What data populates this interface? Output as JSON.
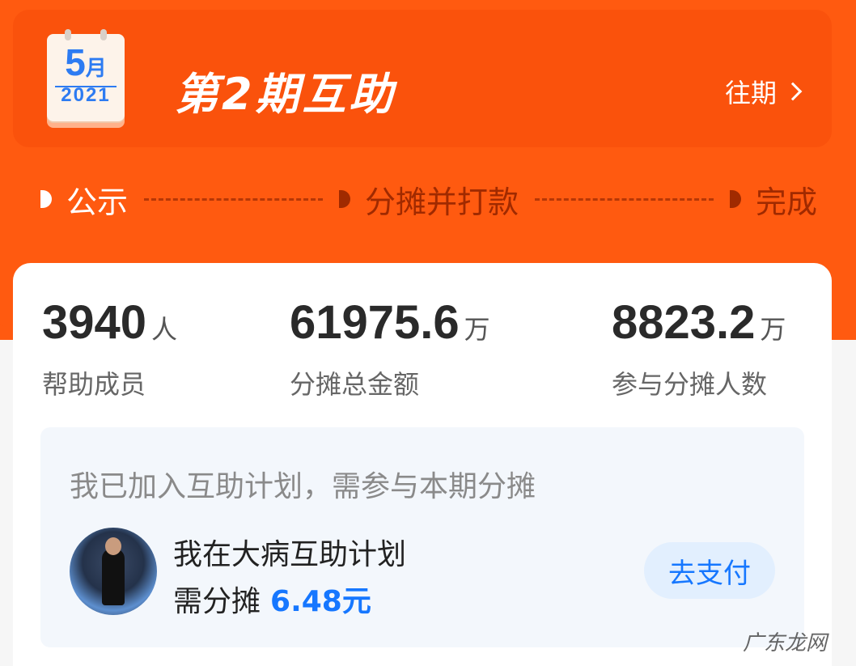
{
  "header": {
    "calendar": {
      "month_number": "5",
      "month_unit": "月",
      "year": "2021"
    },
    "title": "第2期互助",
    "history_label": "往期"
  },
  "steps": [
    {
      "label": "公示",
      "state": "active"
    },
    {
      "label": "分摊并打款",
      "state": "inactive"
    },
    {
      "label": "完成",
      "state": "inactive"
    }
  ],
  "stats": [
    {
      "value": "3940",
      "unit": "人",
      "label": "帮助成员"
    },
    {
      "value": "61975.6",
      "unit": "万",
      "label": "分摊总金额"
    },
    {
      "value": "8823.2",
      "unit": "万",
      "label": "参与分摊人数"
    }
  ],
  "share": {
    "note": "我已加入互助计划，需参与本期分摊",
    "plan_name": "我在大病互助计划",
    "amount_prefix": "需分摊",
    "amount": "6.48元",
    "pay_button": "去支付"
  },
  "watermark": "广东龙网",
  "colors": {
    "primary": "#ff5a10",
    "accent_blue": "#1677ff"
  },
  "icons": {
    "history_chevron": "chevron-right-icon",
    "calendar": "calendar-icon"
  }
}
